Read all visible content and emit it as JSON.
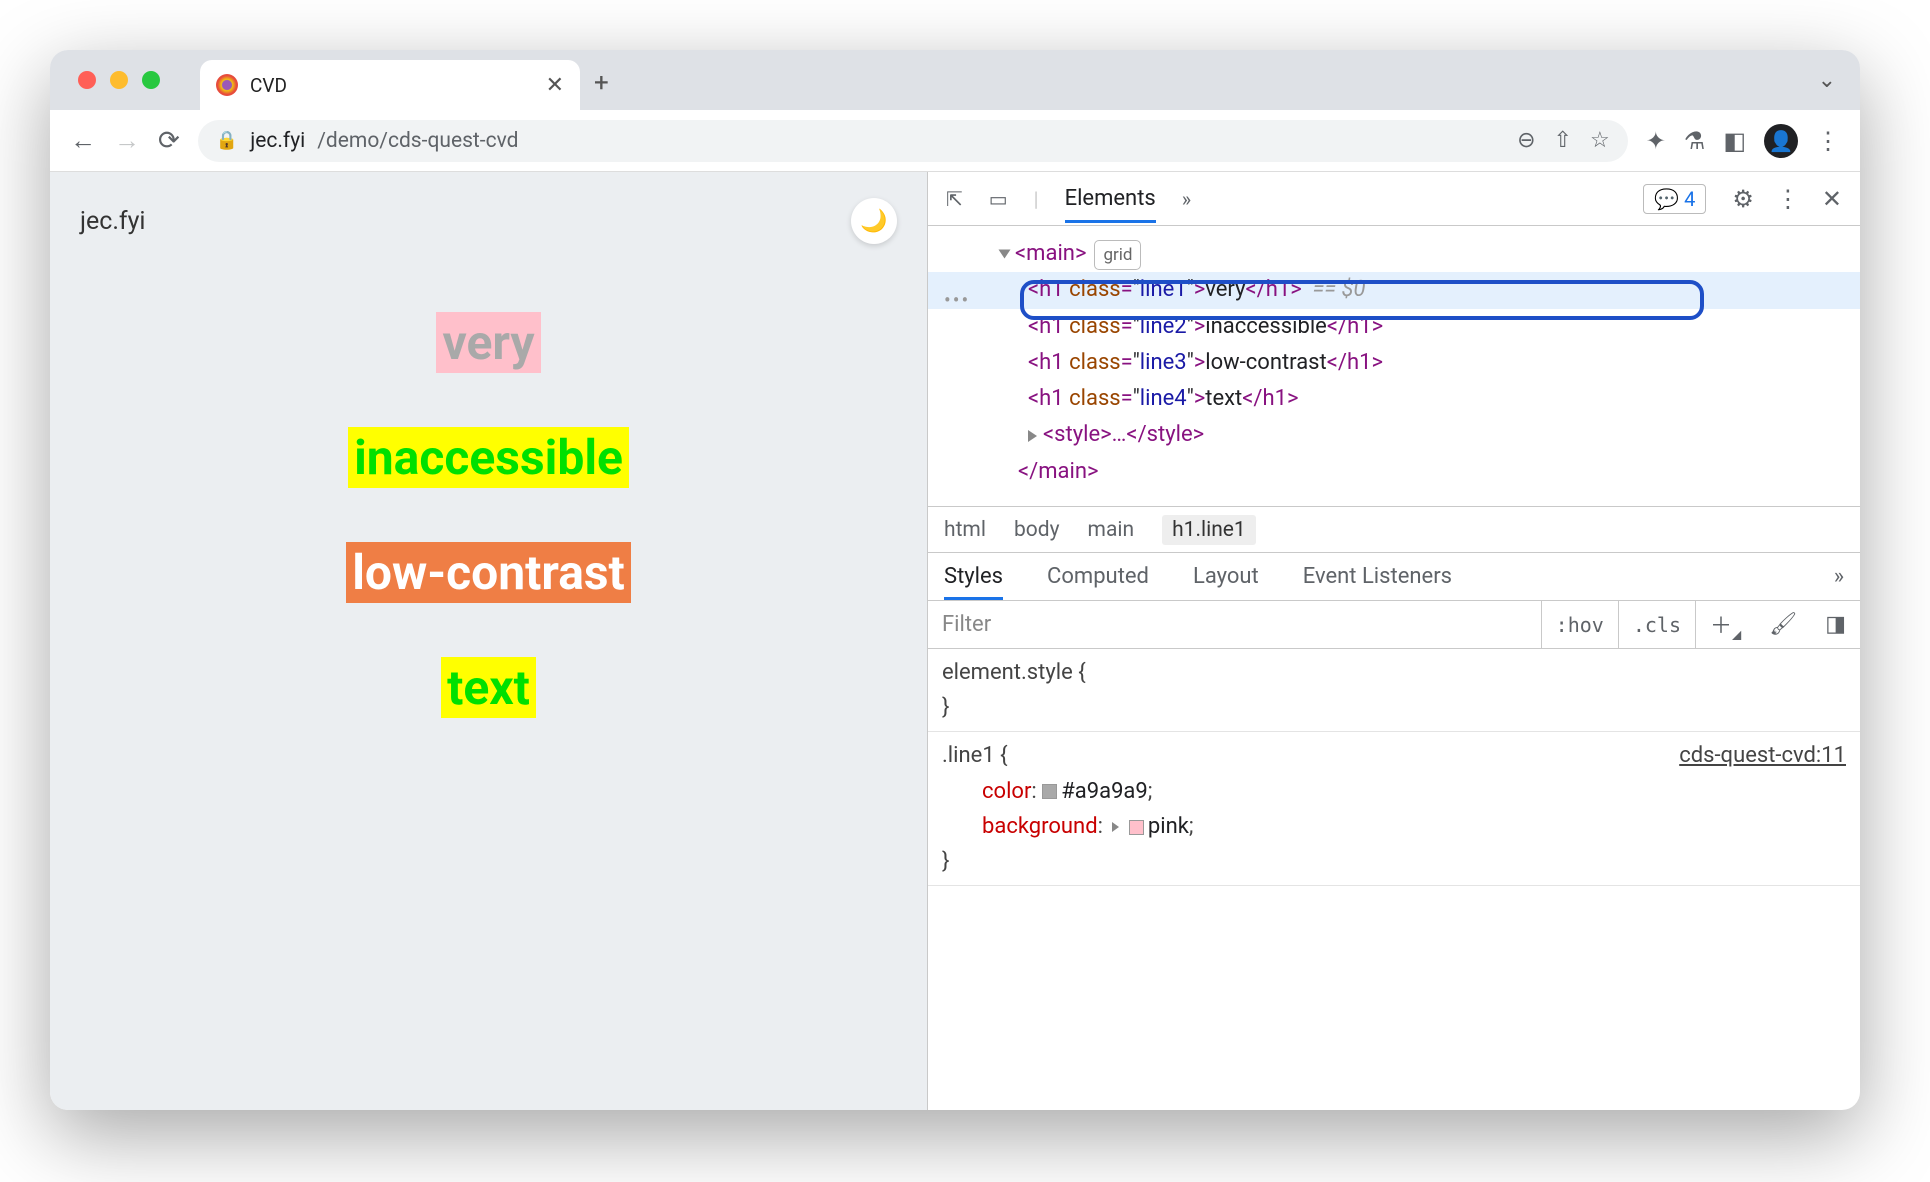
{
  "window": {
    "traffic": {
      "close": "#ff5f57",
      "min": "#febc2e",
      "max": "#28c840"
    }
  },
  "tab": {
    "title": "CVD"
  },
  "toolbar": {
    "url_host": "jec.fyi",
    "url_path": "/demo/cds-quest-cvd"
  },
  "page": {
    "brand": "jec.fyi",
    "lines": [
      {
        "text": "very",
        "fg": "#a9a9a9",
        "bg": "#ffc0cb"
      },
      {
        "text": "inaccessible",
        "fg": "#00e000",
        "bg": "#ffff00"
      },
      {
        "text": "low-contrast",
        "fg": "#ffffff",
        "bg": "#ef7e45"
      },
      {
        "text": "text",
        "fg": "#00e000",
        "bg": "#ffff00"
      }
    ]
  },
  "devtools": {
    "mainTab": "Elements",
    "issuesCount": "4",
    "dom": {
      "parent_open": "<main>",
      "parent_badge": "grid",
      "selected_ref": "== $0",
      "lines": [
        {
          "tag": "h1",
          "class": "line1",
          "text": "very"
        },
        {
          "tag": "h1",
          "class": "line2",
          "text": "inaccessible"
        },
        {
          "tag": "h1",
          "class": "line3",
          "text": "low-contrast"
        },
        {
          "tag": "h1",
          "class": "line4",
          "text": "text"
        }
      ],
      "style_collapsed": "<style>…</style>",
      "parent_close": "</main>"
    },
    "crumbs": [
      "html",
      "body",
      "main",
      "h1.line1"
    ],
    "styleTabs": [
      "Styles",
      "Computed",
      "Layout",
      "Event Listeners"
    ],
    "filter": {
      "placeholder": "Filter",
      "hov": ":hov",
      "cls": ".cls"
    },
    "rules": {
      "element_style": "element.style {",
      "brace_close": "}",
      "rule1_selector": ".line1 {",
      "rule1_src": "cds-quest-cvd:11",
      "rule1_props": [
        {
          "name": "color",
          "swatch": "#a9a9a9",
          "value": "#a9a9a9"
        },
        {
          "name": "background",
          "swatch": "#ffc0cb",
          "value": "pink",
          "disclosure": true
        }
      ]
    }
  }
}
